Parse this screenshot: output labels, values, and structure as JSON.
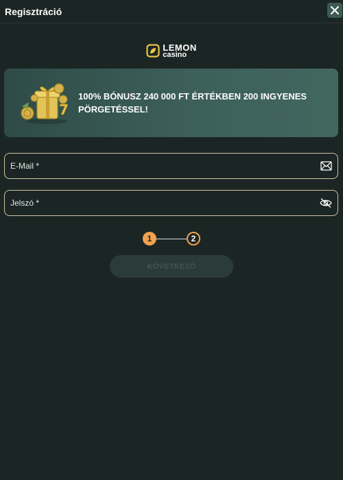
{
  "header": {
    "title": "Regisztráció",
    "close_icon": "close-icon"
  },
  "logo": {
    "line1": "LEMON",
    "line2": "casino",
    "accent_color": "#e8c64a"
  },
  "banner": {
    "text": "100% BÓNUSZ 240 000 FT ÉRTÉKBEN 200 INGYENES PÖRGETÉSSEL!",
    "image_icon": "gift-coins-icon"
  },
  "form": {
    "email_label": "E-Mail *",
    "email_icon": "envelope-icon",
    "password_label": "Jelszó *",
    "password_icon": "eye-off-icon"
  },
  "stepper": {
    "step1": "1",
    "step2": "2",
    "active_step": 1,
    "accent_color": "#f2a14e"
  },
  "next_button": {
    "label": "KÖVETKEZŐ"
  },
  "colors": {
    "background": "#1b2624",
    "banner": "#3c5f5a",
    "field_border": "#cfc3a0"
  }
}
